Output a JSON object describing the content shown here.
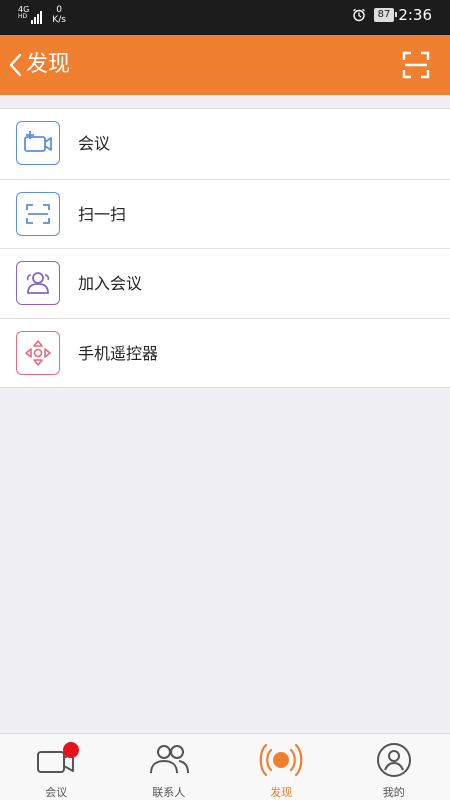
{
  "status_bar": {
    "network": "4G",
    "network_sub": "HD",
    "speed_value": "0",
    "speed_unit": "K/s",
    "battery": "87",
    "time": "2:36",
    "icons": [
      "signal-icon",
      "alarm-icon",
      "battery-icon"
    ]
  },
  "header": {
    "title": "发现",
    "back_icon": "chevron-left-icon",
    "scan_icon": "scan-frame-icon",
    "background": "#f0802f"
  },
  "list": {
    "items": [
      {
        "label": "会议",
        "icon": "video-add-icon",
        "color": "#5b8fe0"
      },
      {
        "label": "扫一扫",
        "icon": "scan-icon",
        "color": "#5b8fe0"
      },
      {
        "label": "加入会议",
        "icon": "group-icon",
        "color": "#8a64c9"
      },
      {
        "label": "手机遥控器",
        "icon": "dpad-icon",
        "color": "#e86a7e"
      }
    ]
  },
  "tabbar": {
    "tabs": [
      {
        "label": "会议",
        "icon": "video-camera-icon",
        "badge": true,
        "active": false
      },
      {
        "label": "联系人",
        "icon": "contacts-icon",
        "badge": false,
        "active": false
      },
      {
        "label": "发现",
        "icon": "broadcast-icon",
        "badge": false,
        "active": true
      },
      {
        "label": "我的",
        "icon": "profile-icon",
        "badge": false,
        "active": false
      }
    ],
    "active_color": "#f0802f"
  }
}
